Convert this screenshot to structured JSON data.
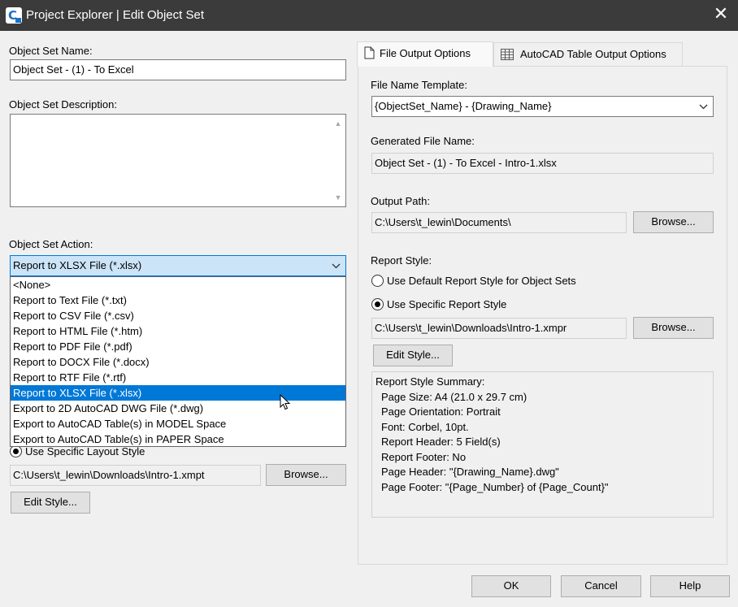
{
  "window": {
    "title": "Project Explorer | Edit Object Set",
    "close_glyph": "✕"
  },
  "left": {
    "name_label": "Object Set Name:",
    "name_value": "Object Set - (1) - To Excel",
    "desc_label": "Object Set Description:",
    "desc_value": "",
    "action_label": "Object Set Action:",
    "action_value": "Report to XLSX File (*.xlsx)",
    "action_options": [
      "<None>",
      "Report to Text File (*.txt)",
      "Report to CSV File (*.csv)",
      "Report to HTML File (*.htm)",
      "Report to PDF File (*.pdf)",
      "Report to DOCX File (*.docx)",
      "Report to RTF File (*.rtf)",
      "Report to XLSX File (*.xlsx)",
      "Export to 2D AutoCAD DWG File (*.dwg)",
      "Export to AutoCAD Table(s) in MODEL Space",
      "Export to AutoCAD Table(s) in PAPER Space"
    ],
    "action_selected_index": 7,
    "layout_radio_label": "Use Specific Layout Style",
    "layout_path": "C:\\Users\\t_lewin\\Downloads\\Intro-1.xmpt",
    "browse_label": "Browse...",
    "edit_style_label": "Edit Style..."
  },
  "tabs": [
    {
      "label": "File Output Options",
      "icon": "document-icon",
      "active": true
    },
    {
      "label": "AutoCAD Table Output Options",
      "icon": "table-icon",
      "active": false
    }
  ],
  "right": {
    "template_label": "File Name Template:",
    "template_value": "{ObjectSet_Name} - {Drawing_Name}",
    "generated_label": "Generated File Name:",
    "generated_value": "Object Set - (1) - To Excel - Intro-1.xlsx",
    "output_path_label": "Output Path:",
    "output_path_value": "C:\\Users\\t_lewin\\Documents\\",
    "browse_label": "Browse...",
    "report_style_label": "Report Style:",
    "radio_default_label": "Use Default Report Style for Object Sets",
    "radio_specific_label": "Use Specific Report Style",
    "radio_selected": "specific",
    "style_path_value": "C:\\Users\\t_lewin\\Downloads\\Intro-1.xmpr",
    "edit_style_label": "Edit Style...",
    "summary": {
      "title": "Report Style Summary:",
      "lines": [
        "Page Size: A4 (21.0 x 29.7 cm)",
        "Page Orientation: Portrait",
        "Font: Corbel, 10pt.",
        "Report Header: 5 Field(s)",
        "Report Footer: No",
        "Page Header: \"{Drawing_Name}.dwg\"",
        "Page Footer: \"{Page_Number} of {Page_Count}\""
      ]
    }
  },
  "footer": {
    "ok_label": "OK",
    "cancel_label": "Cancel",
    "help_label": "Help"
  }
}
